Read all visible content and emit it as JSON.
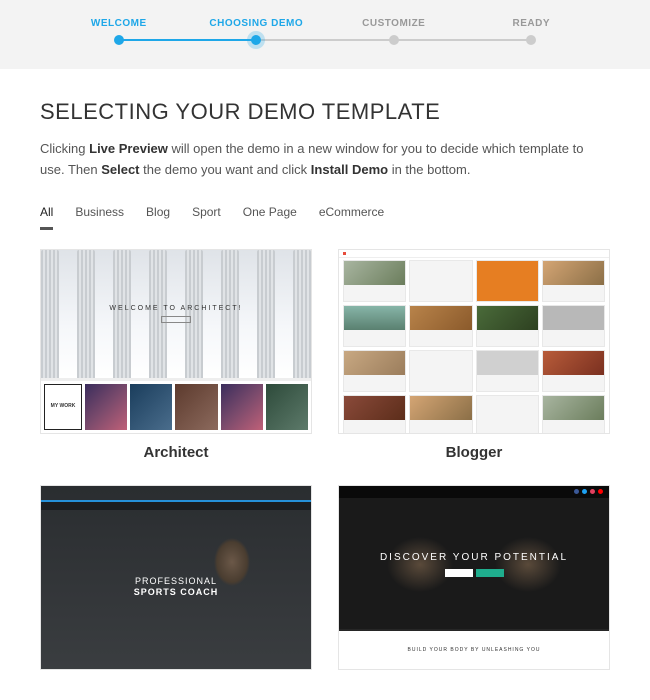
{
  "stepper": {
    "steps": [
      {
        "label": "WELCOME",
        "state": "done"
      },
      {
        "label": "CHOOSING DEMO",
        "state": "active"
      },
      {
        "label": "CUSTOMIZE",
        "state": "pending"
      },
      {
        "label": "READY",
        "state": "pending"
      }
    ]
  },
  "page": {
    "title": "SELECTING YOUR DEMO TEMPLATE",
    "desc_pre": "Clicking ",
    "desc_b1": "Live Preview",
    "desc_mid": " will open the demo in a new window for you to decide which template to use. Then ",
    "desc_b2": "Select",
    "desc_mid2": " the demo you want and click ",
    "desc_b3": "Install Demo",
    "desc_end": " in the bottom."
  },
  "tabs": {
    "items": [
      "All",
      "Business",
      "Blog",
      "Sport",
      "One Page",
      "eCommerce"
    ],
    "active": "All"
  },
  "demos": [
    {
      "title": "Architect",
      "hero_text": "WELCOME TO ARCHITECT!",
      "mywork": "MY WORK"
    },
    {
      "title": "Blogger"
    },
    {
      "title": "",
      "hero_line1": "PROFESSIONAL",
      "hero_line2": "SPORTS COACH"
    },
    {
      "title": "",
      "hero_text": "DISCOVER YOUR POTENTIAL",
      "lower": "BUILD YOUR BODY BY UNLEASHING YOU"
    }
  ],
  "colors": {
    "accent": "#1ea7e8",
    "social": [
      "#3b5998",
      "#1da1f2",
      "#e4405f",
      "#ff0000"
    ]
  }
}
